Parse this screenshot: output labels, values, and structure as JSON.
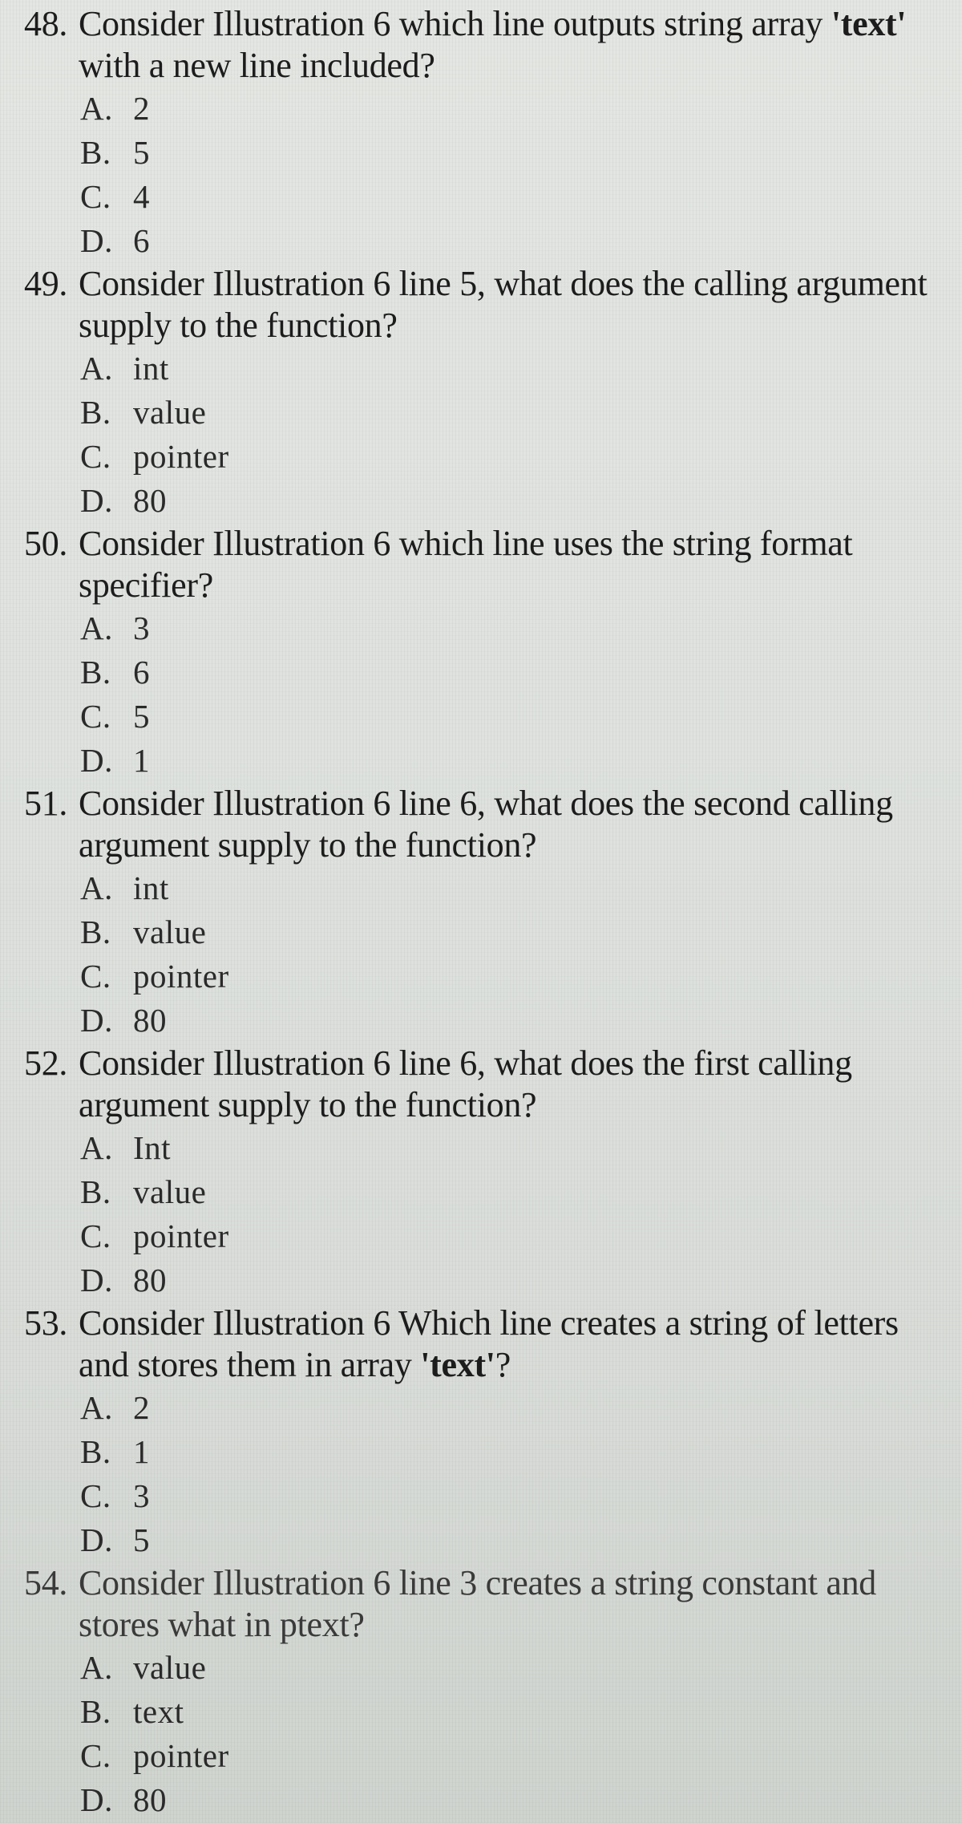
{
  "questions": [
    {
      "number": "48.",
      "text_before": "Consider Illustration 6 which line outputs string array ",
      "text_bold": "'text'",
      "text_after": " with a new line included?",
      "choices": [
        {
          "letter": "A.",
          "value": "2"
        },
        {
          "letter": "B.",
          "value": "5"
        },
        {
          "letter": "C.",
          "value": "4"
        },
        {
          "letter": "D.",
          "value": "6"
        }
      ]
    },
    {
      "number": "49.",
      "text_before": "Consider Illustration 6 line 5, what does the calling argument supply to the function?",
      "text_bold": "",
      "text_after": "",
      "choices": [
        {
          "letter": "A.",
          "value": "int"
        },
        {
          "letter": "B.",
          "value": "value"
        },
        {
          "letter": "C.",
          "value": "pointer"
        },
        {
          "letter": "D.",
          "value": "80"
        }
      ]
    },
    {
      "number": "50.",
      "text_before": "Consider Illustration 6 which line uses the string format specifier?",
      "text_bold": "",
      "text_after": "",
      "choices": [
        {
          "letter": "A.",
          "value": "3"
        },
        {
          "letter": "B.",
          "value": "6"
        },
        {
          "letter": "C.",
          "value": "5"
        },
        {
          "letter": "D.",
          "value": "1"
        }
      ]
    },
    {
      "number": "51.",
      "text_before": "Consider Illustration 6 line 6, what does the second calling argument supply to the function?",
      "text_bold": "",
      "text_after": "",
      "choices": [
        {
          "letter": "A.",
          "value": "int"
        },
        {
          "letter": "B.",
          "value": "value"
        },
        {
          "letter": "C.",
          "value": "pointer"
        },
        {
          "letter": "D.",
          "value": "80"
        }
      ]
    },
    {
      "number": "52.",
      "text_before": "Consider Illustration 6 line 6, what does the first calling argument supply to the function?",
      "text_bold": "",
      "text_after": "",
      "choices": [
        {
          "letter": "A.",
          "value": "Int"
        },
        {
          "letter": "B.",
          "value": "value"
        },
        {
          "letter": "C.",
          "value": "pointer"
        },
        {
          "letter": "D.",
          "value": "80"
        }
      ]
    },
    {
      "number": "53.",
      "text_before": "Consider Illustration 6 Which line creates a string of letters and stores them in array ",
      "text_bold": "'text'",
      "text_after": "?",
      "choices": [
        {
          "letter": "A.",
          "value": "2"
        },
        {
          "letter": "B.",
          "value": "1"
        },
        {
          "letter": "C.",
          "value": "3"
        },
        {
          "letter": "D.",
          "value": "5"
        }
      ]
    },
    {
      "number": "54.",
      "text_before": "Consider Illustration 6 line 3 creates a string constant and stores what in ptext?",
      "text_bold": "",
      "text_after": "",
      "choices": [
        {
          "letter": "A.",
          "value": "value"
        },
        {
          "letter": "B.",
          "value": "text"
        },
        {
          "letter": "C.",
          "value": "pointer"
        },
        {
          "letter": "D.",
          "value": "80"
        }
      ]
    }
  ]
}
